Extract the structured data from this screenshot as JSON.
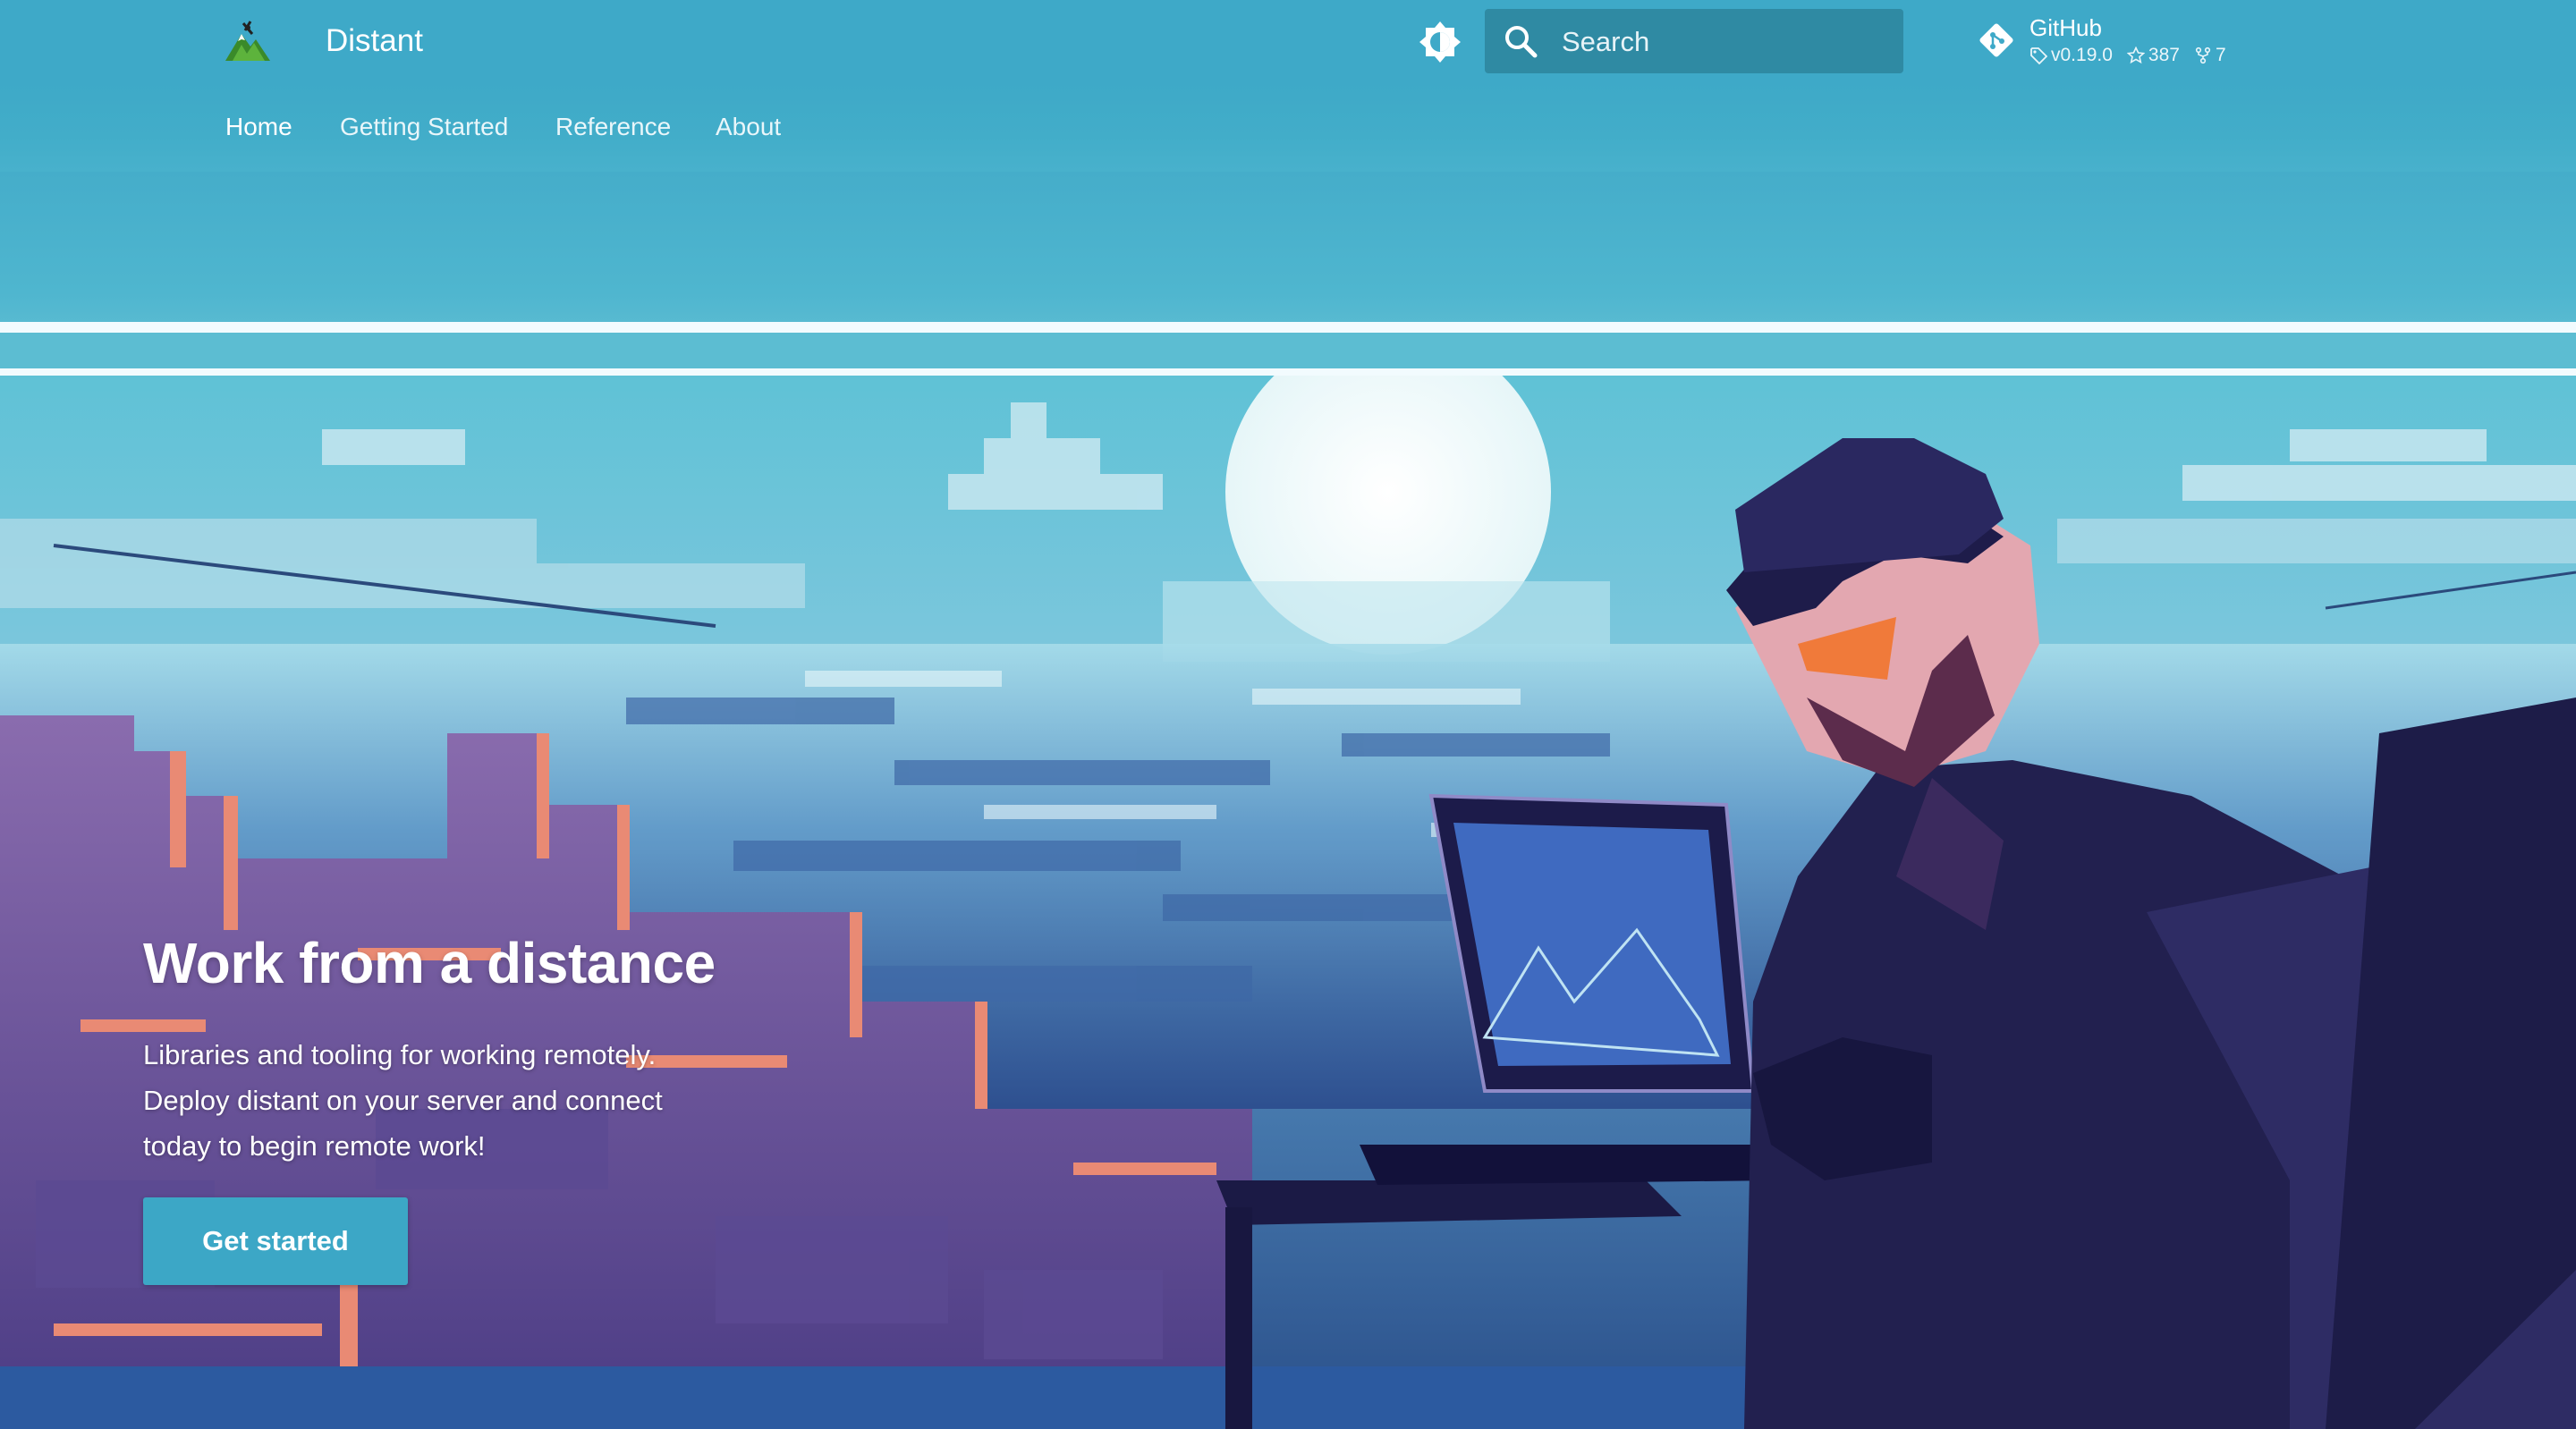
{
  "header": {
    "site_title": "Distant",
    "search_placeholder": "Search",
    "repo": {
      "name": "GitHub",
      "version": "v0.19.0",
      "stars": "387",
      "forks": "7"
    }
  },
  "tabs": [
    {
      "label": "Home",
      "active": true
    },
    {
      "label": "Getting Started",
      "active": false
    },
    {
      "label": "Reference",
      "active": false
    },
    {
      "label": "About",
      "active": false
    }
  ],
  "hero": {
    "title": "Work from a distance",
    "text": "Libraries and tooling for working remotely. Deploy distant on your server and connect today to begin remote work!",
    "cta_label": "Get started"
  },
  "icons": {
    "logo": "mountain-logo-icon",
    "palette": "brightness-icon",
    "search": "search-icon",
    "repo": "git-icon",
    "version": "tag-icon",
    "stars": "star-icon",
    "forks": "fork-icon"
  },
  "colors": {
    "primary": "#3ea9c8",
    "search_bg": "#2f8aa3",
    "text_on_primary": "#ffffff"
  }
}
